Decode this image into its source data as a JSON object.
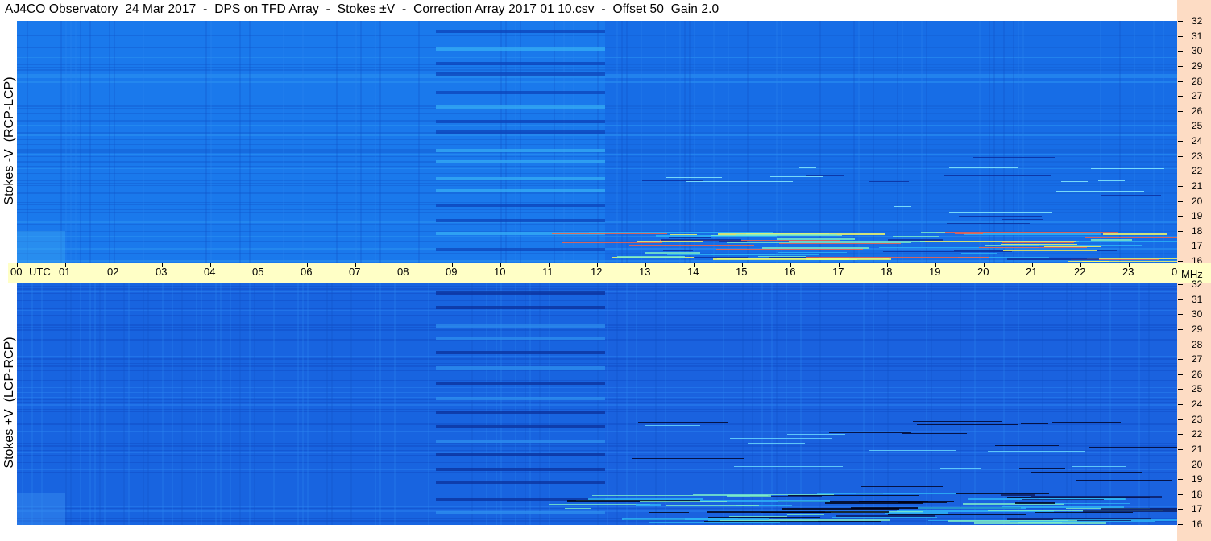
{
  "title": "AJ4CO Observatory  24 Mar 2017  -  DPS on TFD Array  -  Stokes ±V  -  Correction Array 2017 01 10.csv  -  Offset 50  Gain 2.0",
  "chart_data": [
    {
      "type": "heatmap",
      "panel": "top",
      "ylabel": "Stokes -V  (RCP-LCP)",
      "y_ticks": [
        "32",
        "31",
        "30",
        "29",
        "28",
        "27",
        "26",
        "25",
        "24",
        "23",
        "22",
        "21",
        "20",
        "19",
        "18",
        "17",
        "16"
      ],
      "ylim": [
        16,
        32
      ],
      "y_unit": "MHz",
      "x_ticks": [
        "00",
        "01",
        "02",
        "03",
        "04",
        "05",
        "06",
        "07",
        "08",
        "09",
        "10",
        "11",
        "12",
        "13",
        "14",
        "15",
        "16",
        "17",
        "18",
        "19",
        "20",
        "21",
        "22",
        "23",
        "00"
      ],
      "x_unit": "UTC",
      "colormap": [
        "#0a2a9a",
        "#1550d8",
        "#1a7df0",
        "#2eb7f8",
        "#7ef0c8",
        "#ffff60",
        "#ff6040"
      ]
    },
    {
      "type": "heatmap",
      "panel": "bottom",
      "ylabel": "Stokes +V  (LCP-RCP)",
      "y_ticks": [
        "32",
        "31",
        "30",
        "29",
        "28",
        "27",
        "26",
        "25",
        "24",
        "23",
        "22",
        "21",
        "20",
        "19",
        "18",
        "17",
        "16"
      ],
      "ylim": [
        16,
        32
      ],
      "y_unit": "MHz",
      "x_ticks": [
        "00",
        "01",
        "02",
        "03",
        "04",
        "05",
        "06",
        "07",
        "08",
        "09",
        "10",
        "11",
        "12",
        "13",
        "14",
        "15",
        "16",
        "17",
        "18",
        "19",
        "20",
        "21",
        "22",
        "23",
        "00"
      ],
      "x_unit": "UTC",
      "colormap": [
        "#000010",
        "#0a2a9a",
        "#1550d8",
        "#1a7df0",
        "#2eb7f8",
        "#7ef0c8"
      ]
    }
  ],
  "time_axis": {
    "labels": [
      "00",
      "01",
      "02",
      "03",
      "04",
      "05",
      "06",
      "07",
      "08",
      "09",
      "10",
      "11",
      "12",
      "13",
      "14",
      "15",
      "16",
      "17",
      "18",
      "19",
      "20",
      "21",
      "22",
      "23",
      "00"
    ],
    "utc_label": "UTC",
    "mhz_label": "MHz"
  },
  "colors": {
    "axis_band": "#fddcc4",
    "time_band": "#ffffc6",
    "background_blue": "#1a6ee6"
  }
}
